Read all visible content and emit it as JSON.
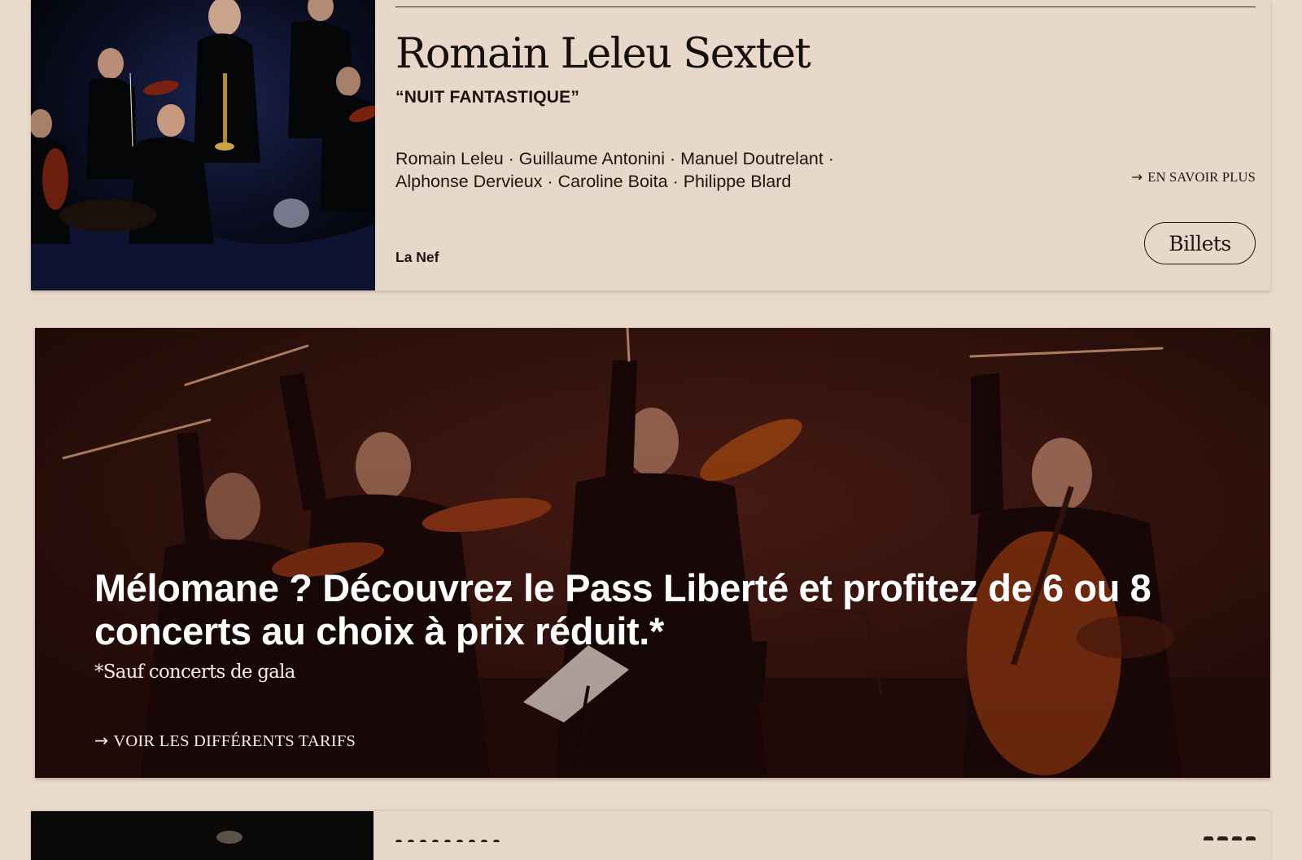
{
  "event": {
    "title": "Romain Leleu Sextet",
    "subtitle": "“NUIT FANTASTIQUE”",
    "performers_line1": "Romain Leleu · Guillaume Antonini · Manuel Doutrelant ·",
    "performers_line2": "Alphonse Dervieux · Caroline Boita · Philippe Blard",
    "more_link": "EN SAVOIR PLUS",
    "venue": "La Nef",
    "tickets_button": "Billets",
    "arrow_icon": "arrow-right-icon"
  },
  "promo": {
    "headline": "Mélomane ? Découvrez le Pass Liberté et profitez de 6 ou 8 concerts au choix à prix réduit.*",
    "note": "*Sauf concerts de gala",
    "link": "VOIR LES DIFFÉRENTS TARIFS",
    "arrow_icon": "arrow-right-icon"
  },
  "colors": {
    "page_background": "#e9dacb",
    "card_background": "#e8d8c9",
    "text": "#1b1410",
    "banner_tint": "#2a100b",
    "banner_text": "#ffffff"
  }
}
